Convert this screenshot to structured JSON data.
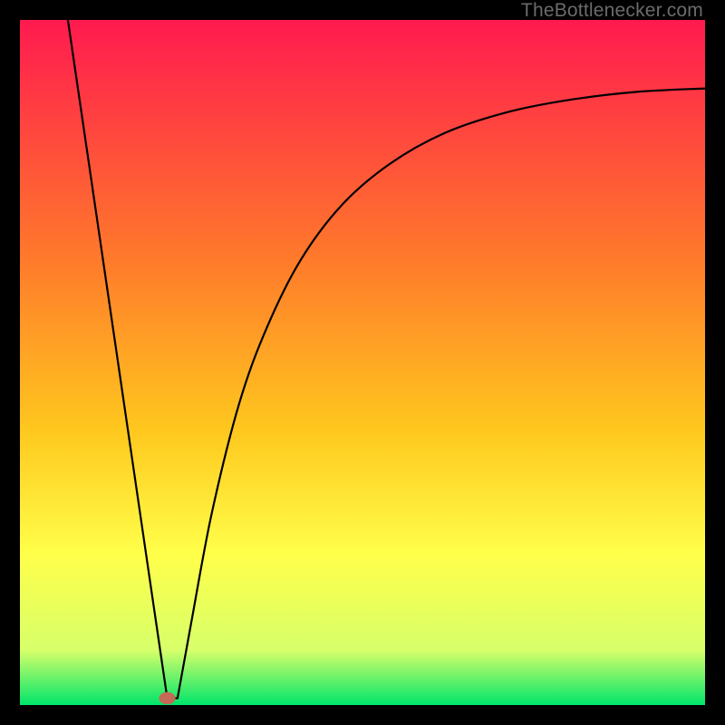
{
  "watermark": "TheBottlenecker.com",
  "chart_data": {
    "type": "line",
    "title": "",
    "xlabel": "",
    "ylabel": "",
    "xlim": [
      0,
      100
    ],
    "ylim": [
      0,
      100
    ],
    "grid": false,
    "legend": false,
    "background_gradient": {
      "stops": [
        {
          "offset": 0.0,
          "color": "#ff1a4f"
        },
        {
          "offset": 0.35,
          "color": "#ff7a2b"
        },
        {
          "offset": 0.6,
          "color": "#ffc81e"
        },
        {
          "offset": 0.78,
          "color": "#ffff4a"
        },
        {
          "offset": 0.92,
          "color": "#d7ff6a"
        },
        {
          "offset": 1.0,
          "color": "#00e56a"
        }
      ]
    },
    "marker": {
      "x": 21.5,
      "y": 1.0,
      "color": "#c46a56",
      "rx": 1.2,
      "ry": 0.9
    },
    "series": [
      {
        "name": "left-branch",
        "x": [
          7.0,
          19.0,
          21.5,
          23.0
        ],
        "y": [
          100.0,
          18.0,
          1.0,
          1.0
        ]
      },
      {
        "name": "right-branch",
        "x": [
          23.0,
          25.0,
          28.0,
          32.0,
          36.0,
          41.0,
          47.0,
          54.0,
          62.0,
          71.0,
          80.0,
          90.0,
          100.0
        ],
        "y": [
          1.0,
          12.0,
          28.0,
          44.0,
          55.0,
          65.0,
          73.0,
          79.0,
          83.5,
          86.5,
          88.3,
          89.5,
          90.0
        ]
      }
    ]
  }
}
